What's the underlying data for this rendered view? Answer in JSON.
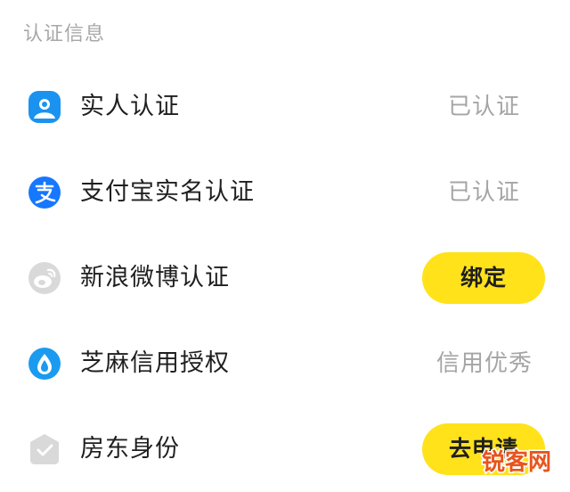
{
  "section": {
    "title": "认证信息"
  },
  "items": [
    {
      "icon": "person-icon",
      "icon_color": "#1a93f0",
      "label": "实人认证",
      "status": "已认证"
    },
    {
      "icon": "alipay-icon",
      "icon_color": "#1677ff",
      "label": "支付宝实名认证",
      "status": "已认证"
    },
    {
      "icon": "weibo-icon",
      "icon_color": "#d9d9d9",
      "label": "新浪微博认证",
      "action": "绑定"
    },
    {
      "icon": "sesame-icon",
      "icon_color": "#1a9bef",
      "label": "芝麻信用授权",
      "status": "信用优秀"
    },
    {
      "icon": "landlord-house-icon",
      "icon_color": "#d9d9d9",
      "label": "房东身份",
      "action": "去申请"
    }
  ],
  "accent_color": "#ffe21a",
  "watermark": {
    "text": "锐客网"
  }
}
